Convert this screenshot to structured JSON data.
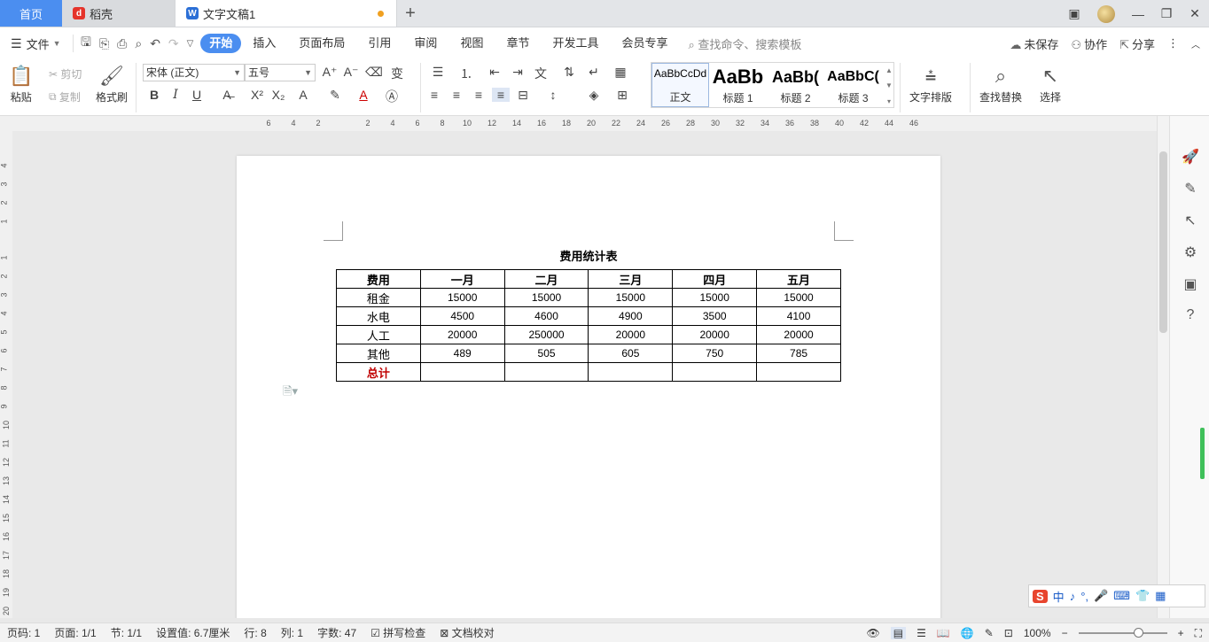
{
  "tabs": {
    "home": "首页",
    "daoke": "稻壳",
    "document": "文字文稿1"
  },
  "menu": {
    "file": "文件",
    "items": [
      "开始",
      "插入",
      "页面布局",
      "引用",
      "审阅",
      "视图",
      "章节",
      "开发工具",
      "会员专享"
    ],
    "search": "查找命令、搜索模板",
    "unsaved": "未保存",
    "collab": "协作",
    "share": "分享"
  },
  "ribbon": {
    "paste": "粘贴",
    "cut": "剪切",
    "copy": "复制",
    "format_painter": "格式刷",
    "font_name": "宋体 (正文)",
    "font_size": "五号",
    "styles": [
      {
        "sample": "AaBbCcDd",
        "name": "正文"
      },
      {
        "sample": "AaBb",
        "name": "标题 1"
      },
      {
        "sample": "AaBb(",
        "name": "标题 2"
      },
      {
        "sample": "AaBbC(",
        "name": "标题 3"
      }
    ],
    "text_layout": "文字排版",
    "find_replace": "查找替换",
    "select": "选择"
  },
  "ruler": {
    "h_left": [
      "6",
      "4",
      "2"
    ],
    "h_right": [
      "2",
      "4",
      "6",
      "8",
      "10",
      "12",
      "14",
      "16",
      "18",
      "20",
      "22",
      "24",
      "26",
      "28",
      "30",
      "32",
      "34",
      "36",
      "38",
      "40",
      "42",
      "44",
      "46"
    ],
    "v_top": [
      "4",
      "3",
      "2",
      "1"
    ],
    "v_bottom": [
      "1",
      "2",
      "3",
      "4",
      "5",
      "6",
      "7",
      "8",
      "9",
      "10",
      "11",
      "12",
      "13",
      "14",
      "15",
      "16",
      "17",
      "18",
      "19",
      "20"
    ]
  },
  "document": {
    "title": "费用统计表",
    "table": {
      "headers": [
        "费用",
        "一月",
        "二月",
        "三月",
        "四月",
        "五月"
      ],
      "rows": [
        [
          "租金",
          "15000",
          "15000",
          "15000",
          "15000",
          "15000"
        ],
        [
          "水电",
          "4500",
          "4600",
          "4900",
          "3500",
          "4100"
        ],
        [
          "人工",
          "20000",
          "250000",
          "20000",
          "20000",
          "20000"
        ],
        [
          "其他",
          "489",
          "505",
          "605",
          "750",
          "785"
        ],
        [
          "总计",
          "",
          "",
          "",
          "",
          ""
        ]
      ]
    }
  },
  "ime": {
    "lang": "中"
  },
  "statusbar": {
    "page_num": "页码: 1",
    "page": "页面: 1/1",
    "section": "节: 1/1",
    "setting": "设置值: 6.7厘米",
    "row": "行: 8",
    "col": "列: 1",
    "words": "字数: 47",
    "spell": "拼写检查",
    "proof": "文档校对",
    "zoom": "100%"
  },
  "colors": {
    "accent": "#4b8ef0",
    "total_text": "#c00000"
  }
}
